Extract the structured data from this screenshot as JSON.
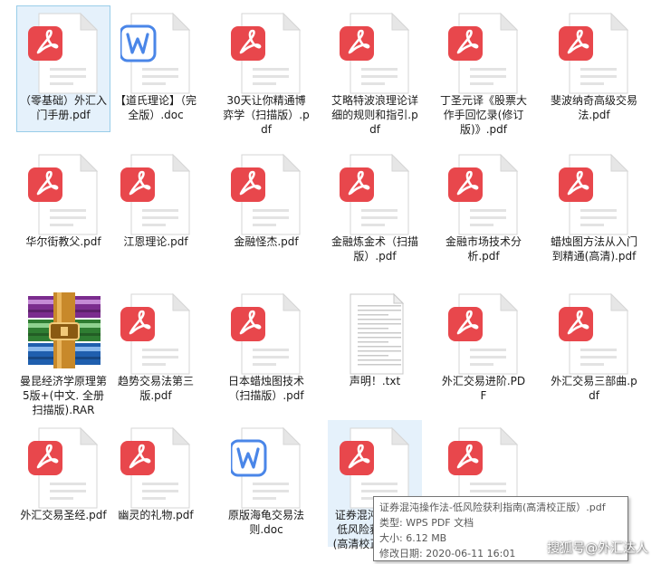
{
  "files": [
    {
      "name": "（零基础）外汇入门手册.pdf",
      "type": "pdf",
      "state": "selected"
    },
    {
      "name": "【道氏理论】（完全版）.doc",
      "type": "doc"
    },
    {
      "name": "30天让你精通博弈学（扫描版）.pdf",
      "type": "pdf"
    },
    {
      "name": "艾略特波浪理论详细的规则和指引.pdf",
      "type": "pdf"
    },
    {
      "name": "丁圣元译《股票大作手回忆录(修订版)》.pdf",
      "type": "pdf"
    },
    {
      "name": "斐波纳奇高级交易法.pdf",
      "type": "pdf"
    },
    {
      "name": "华尔街教父.pdf",
      "type": "pdf"
    },
    {
      "name": "江恩理论.pdf",
      "type": "pdf"
    },
    {
      "name": "金融怪杰.pdf",
      "type": "pdf"
    },
    {
      "name": "金融炼金术（扫描版）.pdf",
      "type": "pdf"
    },
    {
      "name": "金融市场技术分析.pdf",
      "type": "pdf"
    },
    {
      "name": "蜡烛图方法从入门到精通(高清).pdf",
      "type": "pdf"
    },
    {
      "name": "曼昆经济学原理第5版+(中文. 全册扫描版).RAR",
      "type": "rar"
    },
    {
      "name": "趋势交易法第三版.pdf",
      "type": "pdf"
    },
    {
      "name": "日本蜡烛图技术（扫描版）.pdf",
      "type": "pdf"
    },
    {
      "name": "声明！.txt",
      "type": "txt"
    },
    {
      "name": "外汇交易进阶.PDF",
      "type": "pdf"
    },
    {
      "name": "外汇交易三部曲.pdf",
      "type": "pdf"
    },
    {
      "name": "外汇交易圣经.pdf",
      "type": "pdf"
    },
    {
      "name": "幽灵的礼物.pdf",
      "type": "pdf"
    },
    {
      "name": "原版海龟交易法则.doc",
      "type": "doc"
    },
    {
      "name": "证券混沌操作法-低风险获利指南(高清校正版).pdf",
      "type": "pdf",
      "state": "hovered"
    },
    {
      "name": "",
      "type": "pdf"
    }
  ],
  "tooltip": {
    "line1": "证券混沌操作法-低风险获利指南(高清校正版）.pdf",
    "line2": "类型: WPS PDF 文档",
    "line3": "大小: 6.12 MB",
    "line4": "修改日期: 2020-06-11 16:01"
  },
  "watermark": "搜狐号@外汇达人",
  "colors": {
    "pdf": "#e8474c",
    "doc": "#4a86e8",
    "page": "#ffffff",
    "page_border": "#d6d6d6",
    "fold": "#e6e6e6",
    "line": "#e3e3e3"
  }
}
